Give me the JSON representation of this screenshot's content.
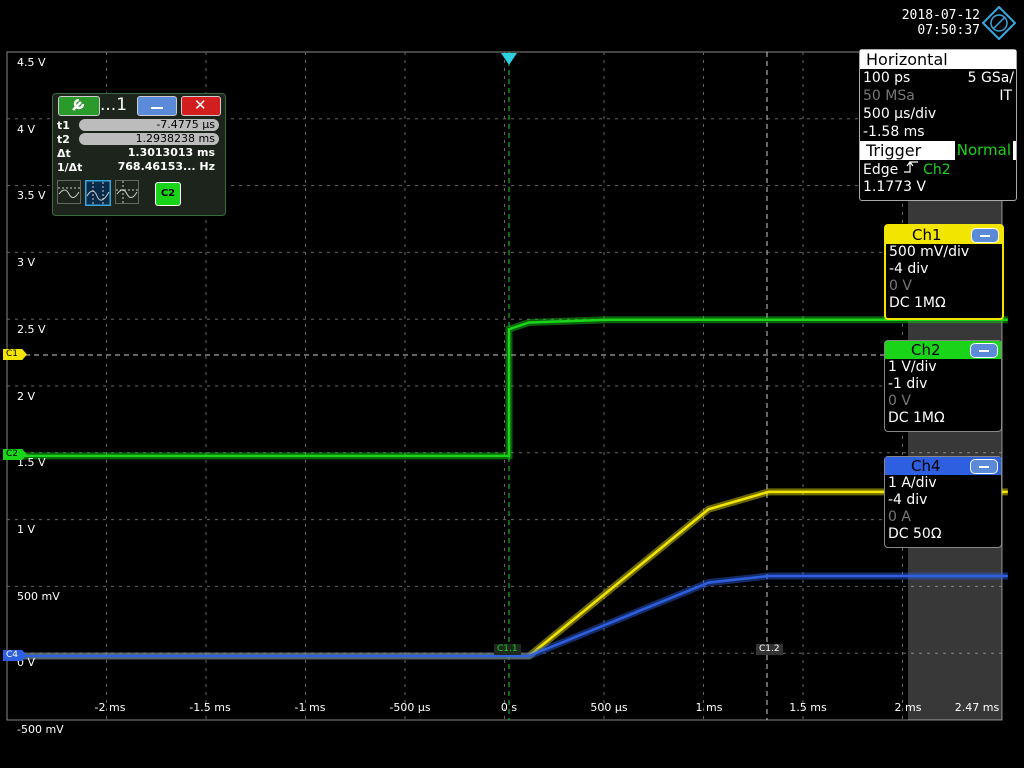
{
  "header": {
    "date": "2018-07-12",
    "time": "07:50:37"
  },
  "y_axis_labels": [
    "4.5 V",
    "4 V",
    "3.5 V",
    "3 V",
    "2.5 V",
    "2 V",
    "1.5 V",
    "1 V",
    "500 mV",
    "0 V",
    "-500 mV"
  ],
  "x_axis_labels": [
    "-2 ms",
    "-1.5 ms",
    "-1 ms",
    "-500 µs",
    "0 s",
    "500 µs",
    "1 ms",
    "1.5 ms",
    "2 ms",
    "2.47 ms"
  ],
  "cursor_box": {
    "title": "...1",
    "rows": [
      {
        "label": "t1",
        "value": "-7.4775 µs"
      },
      {
        "label": "t2",
        "value": "1.2938238 ms"
      },
      {
        "label": "Δt",
        "value": "1.3013013 ms"
      },
      {
        "label": "1/Δt",
        "value": "768.46153... Hz"
      }
    ],
    "source_badge": "C2"
  },
  "horizontal": {
    "title": "Horizontal",
    "resolution": "100 ps",
    "sample_rate": "5 GSa/",
    "record": "50 MSa",
    "mode": "IT",
    "scale": "500 µs/div",
    "position": "-1.58 ms"
  },
  "trigger": {
    "title": "Trigger",
    "mode": "Normal",
    "type": "Edge",
    "source": "Ch2",
    "level": "1.1773 V"
  },
  "channels": [
    {
      "name": "Ch1",
      "scale": "500 mV/div",
      "offset": "-4 div",
      "position": "0 V",
      "coupling": "DC 1MΩ",
      "color": "#f2e600"
    },
    {
      "name": "Ch2",
      "scale": "1 V/div",
      "offset": "-1 div",
      "position": "0 V",
      "coupling": "DC 1MΩ",
      "color": "#19d419"
    },
    {
      "name": "Ch4",
      "scale": "1 A/div",
      "offset": "-4 div",
      "position": "0 A",
      "coupling": "DC 50Ω",
      "color": "#2e5fe0"
    }
  ],
  "markers": {
    "c1": "C1",
    "c2": "C2",
    "c4": "C4",
    "c1_1": "C1.1",
    "c1_2": "C1.2"
  },
  "chart_data": {
    "type": "line",
    "xlim": [
      -2.5,
      2.5
    ],
    "grid": true,
    "series": [
      {
        "name": "Ch1",
        "color": "#f2e600",
        "x": [
          -2.5,
          0.1,
          1.0,
          1.3,
          2.5
        ],
        "y": [
          0,
          0,
          1.1,
          1.23,
          1.23
        ]
      },
      {
        "name": "Ch2",
        "color": "#19d419",
        "x": [
          -2.5,
          0,
          0,
          0.1,
          0.5,
          2.5
        ],
        "y": [
          1.5,
          1.5,
          2.45,
          2.5,
          2.52,
          2.52
        ]
      },
      {
        "name": "Ch4",
        "color": "#2e5fe0",
        "x": [
          -2.5,
          0.1,
          1.0,
          1.3,
          2.5
        ],
        "y": [
          0,
          0,
          0.55,
          0.6,
          0.6
        ]
      }
    ]
  }
}
